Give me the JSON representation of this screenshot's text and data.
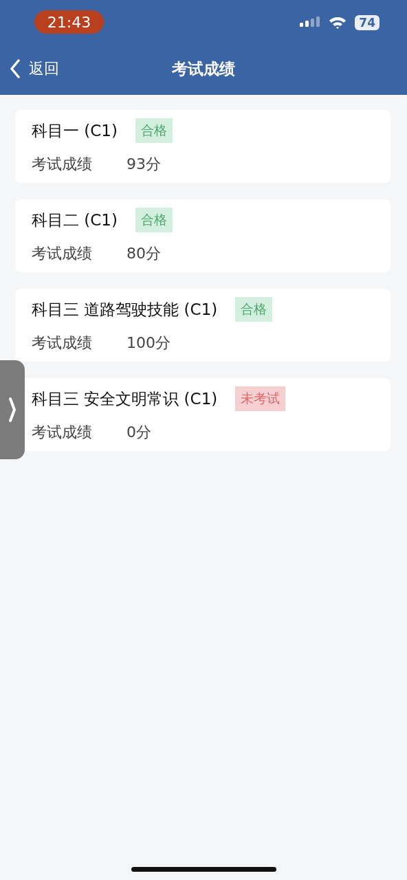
{
  "status_bar": {
    "time": "21:43",
    "battery": "74"
  },
  "nav_bar": {
    "back": "返回",
    "title": "考试成绩"
  },
  "results": [
    {
      "subject": "科目一 (C1)",
      "status": {
        "label": "合格",
        "kind": "pass"
      },
      "score_label": "考试成绩",
      "score": "93分"
    },
    {
      "subject": "科目二 (C1)",
      "status": {
        "label": "合格",
        "kind": "pass"
      },
      "score_label": "考试成绩",
      "score": "80分"
    },
    {
      "subject": "科目三 道路驾驶技能 (C1)",
      "status": {
        "label": "合格",
        "kind": "pass"
      },
      "score_label": "考试成绩",
      "score": "100分"
    },
    {
      "subject": "科目三 安全文明常识 (C1)",
      "status": {
        "label": "未考试",
        "kind": "not_taken"
      },
      "score_label": "考试成绩",
      "score": "0分"
    }
  ]
}
